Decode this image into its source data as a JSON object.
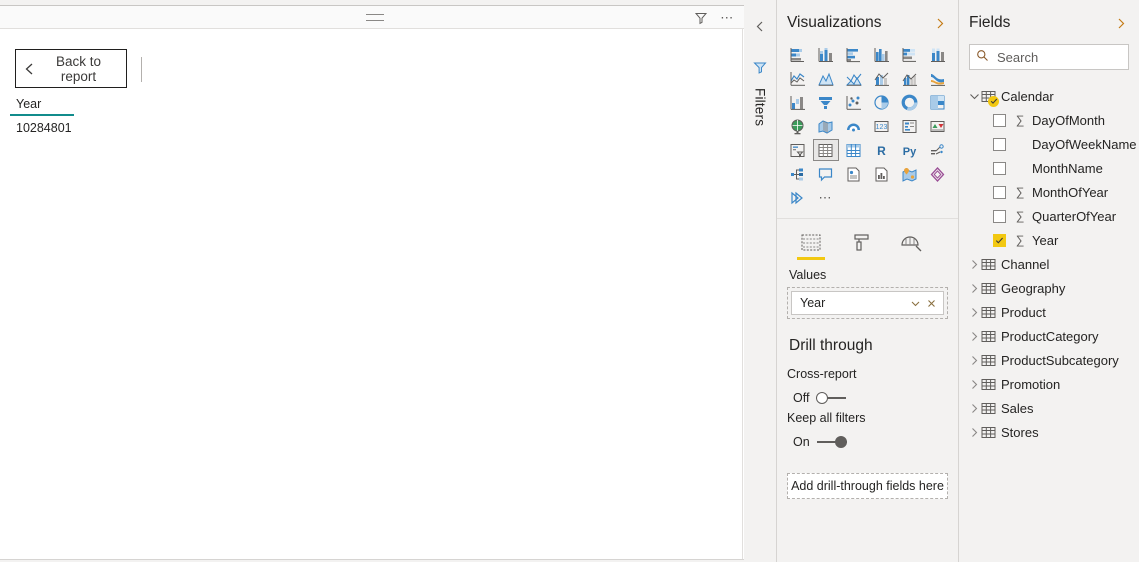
{
  "report": {
    "header": {
      "drag_handle_icon": "drag-handle-icon",
      "filter_icon": "funnel-icon",
      "more_options_icon": "ellipsis-horizontal-icon"
    },
    "back_button": {
      "label": "Back to report",
      "icon": "chevron-left-icon"
    },
    "table_visual": {
      "column_header": "Year",
      "value": "10284801",
      "accent_color": "#118c8c"
    }
  },
  "filters_rail": {
    "label": "Filters",
    "expand_icon": "chevron-left-icon",
    "funnel_icon": "funnel-icon"
  },
  "visualizations": {
    "title": "Visualizations",
    "collapse_icon": "chevron-right-icon",
    "icons": [
      "stacked-bar-chart-icon",
      "stacked-column-chart-icon",
      "clustered-bar-chart-icon",
      "clustered-column-chart-icon",
      "hundred-percent-stacked-bar-chart-icon",
      "hundred-percent-stacked-column-chart-icon",
      "line-chart-icon",
      "area-chart-icon",
      "stacked-area-chart-icon",
      "line-and-stacked-column-chart-icon",
      "line-and-clustered-column-chart-icon",
      "ribbon-chart-icon",
      "waterfall-chart-icon",
      "funnel-chart-icon",
      "scatter-chart-icon",
      "pie-chart-icon",
      "donut-chart-icon",
      "treemap-icon",
      "map-icon",
      "filled-map-icon",
      "arcgis-map-icon",
      "card-icon",
      "multi-row-card-icon",
      "kpi-icon",
      "slicer-icon",
      "table-icon",
      "matrix-icon",
      "r-script-visual-icon",
      "python-visual-icon",
      "decomposition-tree-icon",
      "key-influencers-icon",
      "qna-icon",
      "smart-narrative-icon",
      "paginated-report-icon",
      "azure-map-icon",
      "power-apps-icon",
      "power-automate-icon",
      "more-visuals-icon"
    ],
    "selected_icon": "table-icon",
    "wells_tabs": [
      {
        "name": "fields-tab",
        "icon": "fields-well-icon",
        "active": true
      },
      {
        "name": "format-tab",
        "icon": "paint-roller-icon",
        "active": false
      },
      {
        "name": "analytics-tab",
        "icon": "analytics-magnifier-icon",
        "active": false
      }
    ],
    "wells_active_underline_color": "#f2c811",
    "values_well": {
      "label": "Values",
      "fields": [
        {
          "name": "Year",
          "menu_icon": "chevron-down-icon",
          "remove_icon": "close-icon"
        }
      ]
    },
    "drill_through": {
      "title": "Drill through",
      "cross_report": {
        "label": "Cross-report",
        "state_label": "Off",
        "state": "off"
      },
      "keep_all_filters": {
        "label": "Keep all filters",
        "state_label": "On",
        "state": "on"
      },
      "drop_zone_label": "Add drill-through fields here"
    }
  },
  "fields": {
    "title": "Fields",
    "collapse_icon": "chevron-right-icon",
    "search": {
      "placeholder": "Search",
      "value": "",
      "icon": "search-icon"
    },
    "tree": [
      {
        "name": "Calendar",
        "expanded": true,
        "has_check_badge": true,
        "children": [
          {
            "name": "DayOfMonth",
            "checked": false,
            "numeric": true
          },
          {
            "name": "DayOfWeekName",
            "checked": false,
            "numeric": false
          },
          {
            "name": "MonthName",
            "checked": false,
            "numeric": false
          },
          {
            "name": "MonthOfYear",
            "checked": false,
            "numeric": true
          },
          {
            "name": "QuarterOfYear",
            "checked": false,
            "numeric": true
          },
          {
            "name": "Year",
            "checked": true,
            "numeric": true
          }
        ]
      },
      {
        "name": "Channel",
        "expanded": false,
        "children": []
      },
      {
        "name": "Geography",
        "expanded": false,
        "children": []
      },
      {
        "name": "Product",
        "expanded": false,
        "children": []
      },
      {
        "name": "ProductCategory",
        "expanded": false,
        "children": []
      },
      {
        "name": "ProductSubcategory",
        "expanded": false,
        "children": []
      },
      {
        "name": "Promotion",
        "expanded": false,
        "children": []
      },
      {
        "name": "Sales",
        "expanded": false,
        "children": []
      },
      {
        "name": "Stores",
        "expanded": false,
        "children": []
      }
    ]
  },
  "theme": {
    "accent_yellow": "#f2c811",
    "pane_bg": "#f3f2f1",
    "canvas_bg": "#ffffff",
    "viz_blue": "#3b87c8"
  }
}
